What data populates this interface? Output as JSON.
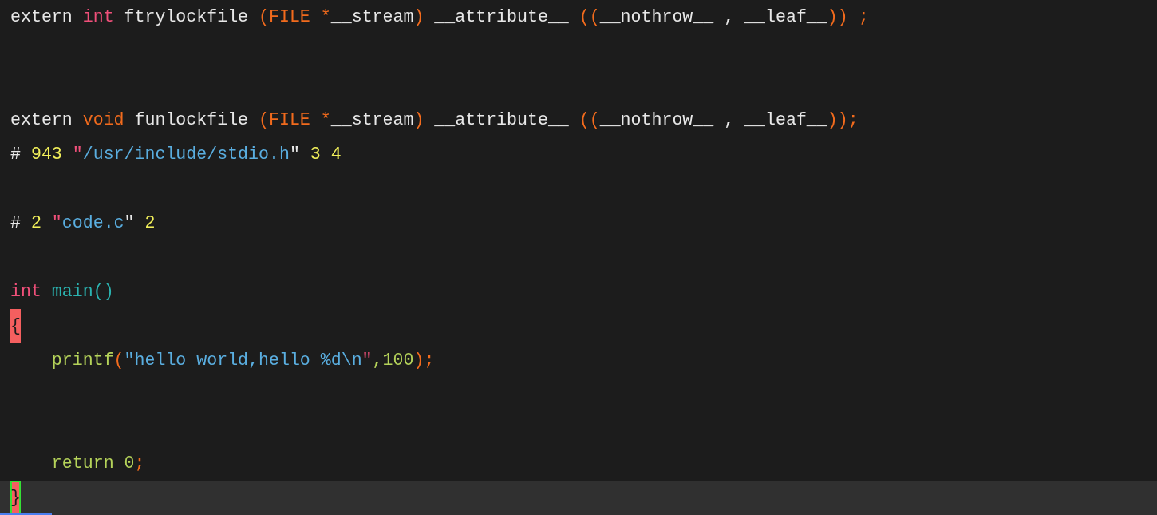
{
  "editor": {
    "lines": [
      {
        "kind": "code",
        "current": false,
        "tokens": [
          {
            "text": "extern ",
            "color": "#e8e8e8"
          },
          {
            "text": "int",
            "color": "#f0507a"
          },
          {
            "text": " ftrylockfile ",
            "color": "#e8e8e8"
          },
          {
            "text": "(FILE *",
            "color": "#f26b1d"
          },
          {
            "text": "__stream",
            "color": "#e8e8e8"
          },
          {
            "text": ")",
            "color": "#f26b1d"
          },
          {
            "text": " __attribute__ ",
            "color": "#e8e8e8"
          },
          {
            "text": "((",
            "color": "#f26b1d"
          },
          {
            "text": "__nothrow__ , __leaf__",
            "color": "#e8e8e8"
          },
          {
            "text": ")) ;",
            "color": "#f26b1d"
          }
        ]
      },
      {
        "kind": "blank",
        "current": false
      },
      {
        "kind": "blank",
        "current": false
      },
      {
        "kind": "code",
        "current": false,
        "tokens": [
          {
            "text": "extern ",
            "color": "#e8e8e8"
          },
          {
            "text": "void",
            "color": "#f26b1d"
          },
          {
            "text": " funlockfile ",
            "color": "#e8e8e8"
          },
          {
            "text": "(FILE *",
            "color": "#f26b1d"
          },
          {
            "text": "__stream",
            "color": "#e8e8e8"
          },
          {
            "text": ")",
            "color": "#f26b1d"
          },
          {
            "text": " __attribute__ ",
            "color": "#e8e8e8"
          },
          {
            "text": "((",
            "color": "#f26b1d"
          },
          {
            "text": "__nothrow__ , __leaf__",
            "color": "#e8e8e8"
          },
          {
            "text": "));",
            "color": "#f26b1d"
          }
        ]
      },
      {
        "kind": "code",
        "current": false,
        "tokens": [
          {
            "text": "# ",
            "color": "#e8e8e8"
          },
          {
            "text": "943 ",
            "color": "#f2f05a"
          },
          {
            "text": "\"",
            "color": "#f0507a"
          },
          {
            "text": "/usr/include/stdio.h",
            "color": "#5aaee0"
          },
          {
            "text": "\"",
            "color": "#e8e8e8"
          },
          {
            "text": " 3 4",
            "color": "#f2f05a"
          }
        ]
      },
      {
        "kind": "blank",
        "current": false
      },
      {
        "kind": "code",
        "current": false,
        "tokens": [
          {
            "text": "# ",
            "color": "#e8e8e8"
          },
          {
            "text": "2 ",
            "color": "#f2f05a"
          },
          {
            "text": "\"",
            "color": "#f0507a"
          },
          {
            "text": "code.c",
            "color": "#5aaee0"
          },
          {
            "text": "\"",
            "color": "#e8e8e8"
          },
          {
            "text": " 2",
            "color": "#f2f05a"
          }
        ]
      },
      {
        "kind": "blank",
        "current": false
      },
      {
        "kind": "code",
        "current": false,
        "tokens": [
          {
            "text": "int",
            "color": "#f0507a"
          },
          {
            "text": " main()",
            "color": "#2bb3b0"
          }
        ]
      },
      {
        "kind": "code",
        "current": false,
        "tokens": [
          {
            "text": "{",
            "match": true,
            "cursor": false
          }
        ]
      },
      {
        "kind": "code",
        "current": false,
        "tokens": [
          {
            "text": "    printf",
            "color": "#b5d35a"
          },
          {
            "text": "(",
            "color": "#f26b1d"
          },
          {
            "text": "\"hello world,hello %d\\n",
            "color": "#5aaee0"
          },
          {
            "text": "\"",
            "color": "#f0507a"
          },
          {
            "text": ",100",
            "color": "#b5d35a"
          },
          {
            "text": ");",
            "color": "#f26b1d"
          }
        ]
      },
      {
        "kind": "blank",
        "current": false
      },
      {
        "kind": "blank",
        "current": false
      },
      {
        "kind": "code",
        "current": false,
        "tokens": [
          {
            "text": "    return 0",
            "color": "#b5d35a"
          },
          {
            "text": ";",
            "color": "#f26b1d"
          }
        ]
      },
      {
        "kind": "code",
        "current": true,
        "tokens": [
          {
            "text": "}",
            "match": true,
            "cursor": true
          }
        ]
      }
    ]
  }
}
